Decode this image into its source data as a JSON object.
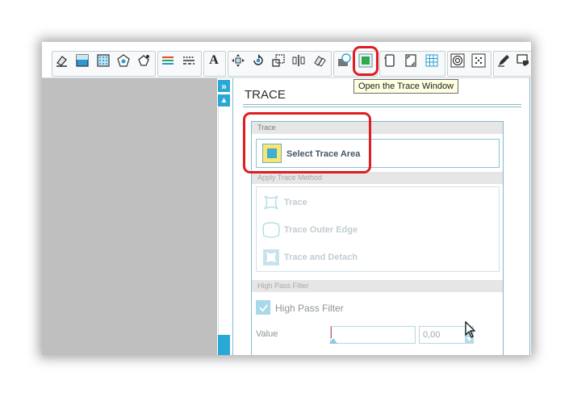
{
  "toolbar": {
    "tools": [
      {
        "name": "eraser-icon"
      },
      {
        "name": "fill-icon"
      },
      {
        "name": "pattern-fill-icon"
      },
      {
        "name": "shape-fill-icon"
      },
      {
        "name": "offset-icon"
      },
      {
        "name": "line-color-icon"
      },
      {
        "name": "line-style-icon"
      },
      {
        "name": "text-icon",
        "glyph": "A"
      },
      {
        "name": "transform-icon"
      },
      {
        "name": "rotate-icon"
      },
      {
        "name": "scale-icon"
      },
      {
        "name": "align-icon"
      },
      {
        "name": "replicate-icon"
      },
      {
        "name": "modify-icon"
      },
      {
        "name": "trace-icon"
      },
      {
        "name": "page-icon"
      },
      {
        "name": "registration-icon"
      },
      {
        "name": "grid-icon"
      },
      {
        "name": "offset-rings-icon"
      },
      {
        "name": "dots-icon"
      },
      {
        "name": "sketch-icon"
      },
      {
        "name": "send-icon"
      }
    ],
    "tooltip": "Open the Trace Window"
  },
  "sidebar": {
    "expand_glyph": "»",
    "up_glyph": "▲"
  },
  "panel": {
    "title": "TRACE",
    "sections": {
      "trace": "Trace",
      "method": "Apply Trace Method",
      "filter": "High Pass Filter"
    },
    "select_trace_area": "Select Trace Area",
    "methods": [
      "Trace",
      "Trace Outer Edge",
      "Trace and Detach"
    ],
    "high_pass_filter": {
      "label": "High Pass Filter",
      "checked": true
    },
    "value": {
      "label": "Value",
      "number": "0,00",
      "slider_fraction": 0
    }
  },
  "colors": {
    "accent": "#29a8d6",
    "highlight": "#e01c23",
    "trace_icon": "#f3e873"
  }
}
